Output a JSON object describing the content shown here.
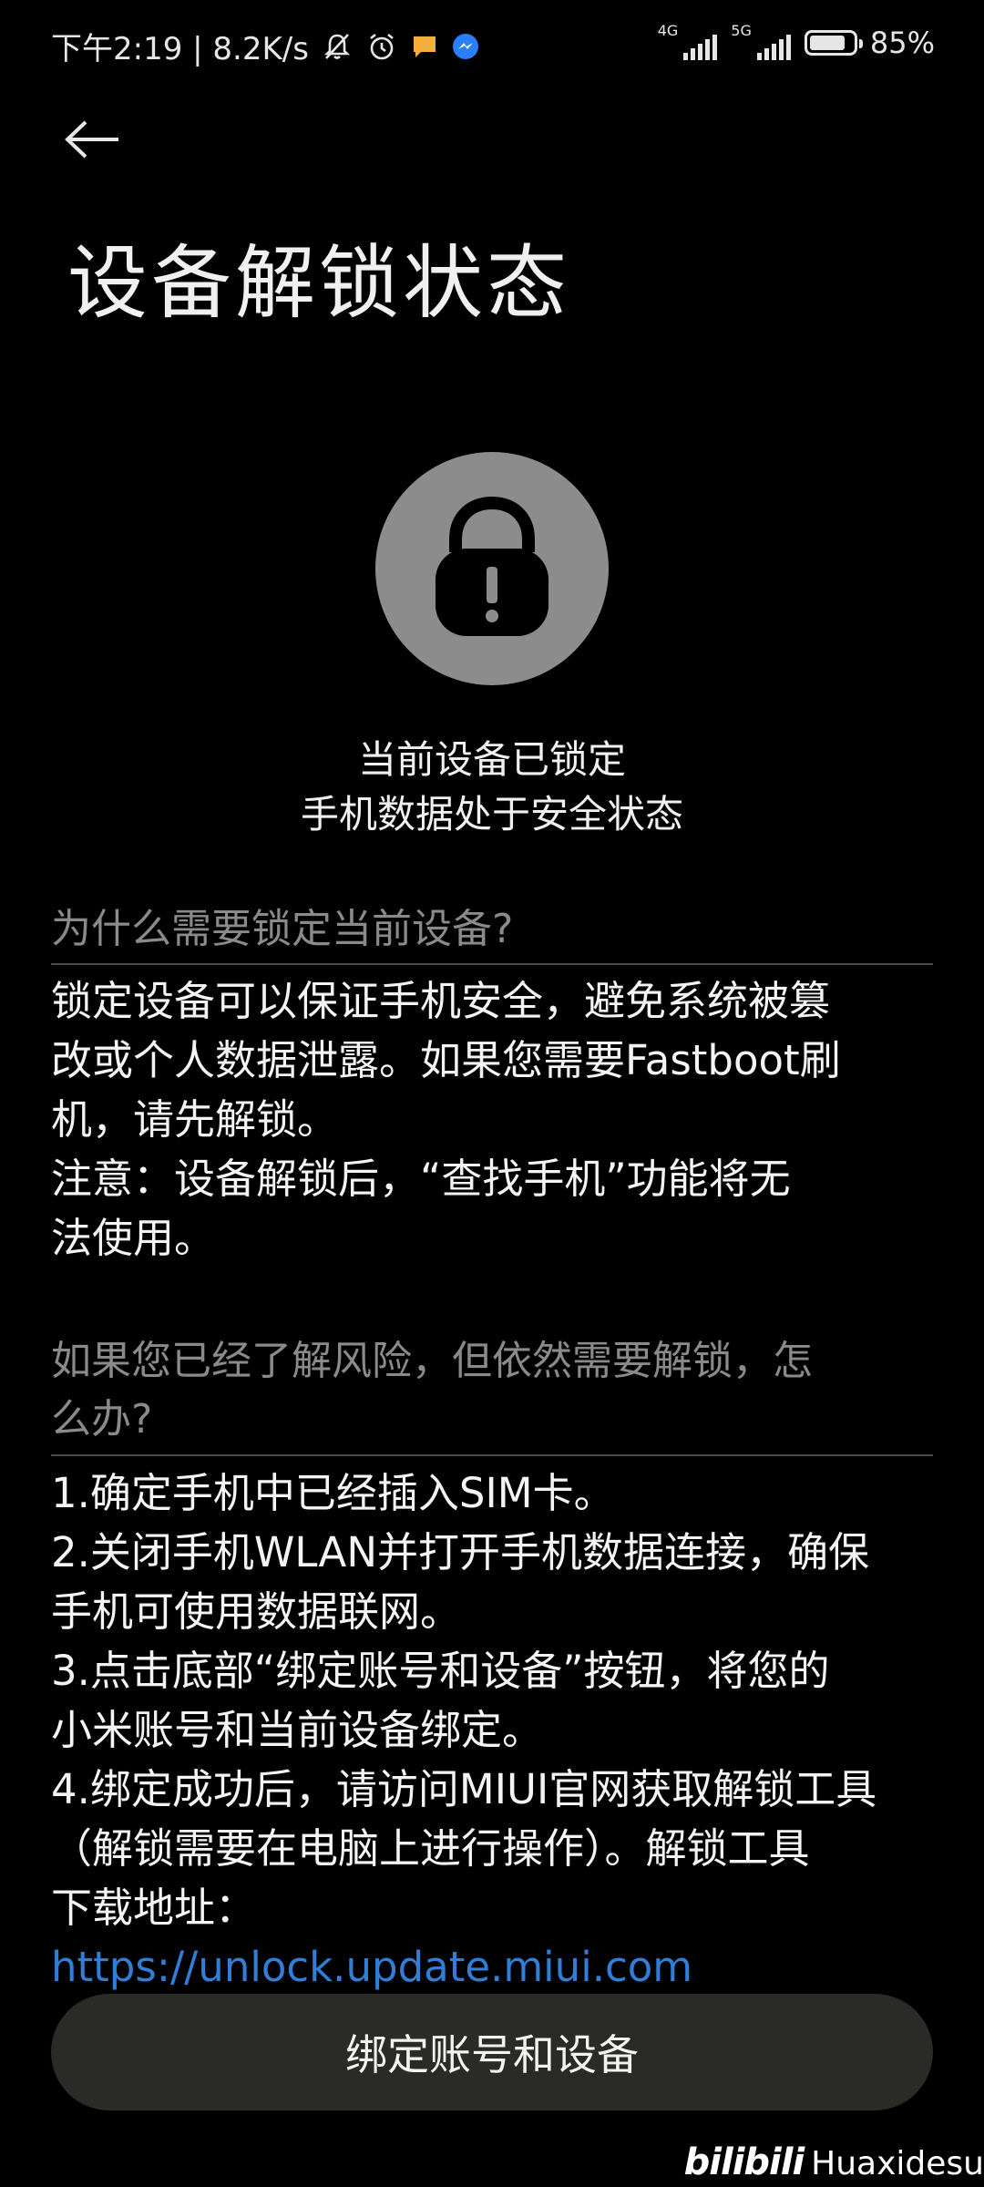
{
  "status_bar": {
    "time_speed": "下午2:19 | 8.2K/s",
    "net_tag_1": "4G",
    "net_tag_2": "5G",
    "battery_percent": "85%",
    "battery_level": 0.85,
    "icons": [
      "bell-off-icon",
      "alarm-icon",
      "message-icon",
      "messenger-icon",
      "signal-icon",
      "battery-icon"
    ]
  },
  "header": {
    "title": "设备解锁状态"
  },
  "lock_status": {
    "line1": "当前设备已锁定",
    "line2": "手机数据处于安全状态"
  },
  "section1": {
    "title": "为什么需要锁定当前设备?",
    "body": "锁定设备可以保证手机安全，避免系统被篡\n改或个人数据泄露。如果您需要Fastboot刷\n机，请先解锁。\n注意：设备解锁后，“查找手机”功能将无\n法使用。"
  },
  "section2": {
    "title": "如果您已经了解风险，但依然需要解锁，怎\n么办?",
    "body": "1.确定手机中已经插入SIM卡。\n2.关闭手机WLAN并打开手机数据连接，确保\n手机可使用数据联网。\n3.点击底部“绑定账号和设备”按钮，将您的\n小米账号和当前设备绑定。\n4.绑定成功后，请访问MIUI官网获取解锁工具\n（解锁需要在电脑上进行操作）。解锁工具\n下载地址：",
    "link": "https://unlock.update.miui.com"
  },
  "button": {
    "label": "绑定账号和设备"
  },
  "watermark": {
    "logo": "bilibili",
    "user": "Huaxidesu"
  },
  "colors": {
    "background": "#000000",
    "link": "#2f7fd8",
    "button_bg": "#2a2a27",
    "lock_circle": "#8c8c8c"
  }
}
